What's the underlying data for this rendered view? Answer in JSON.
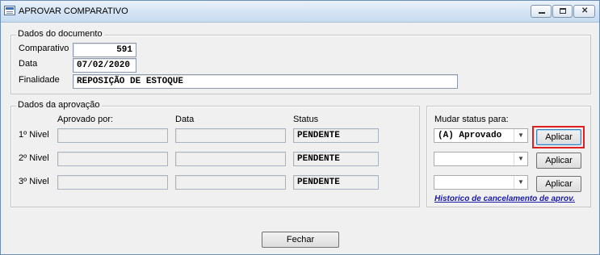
{
  "window": {
    "title": "APROVAR COMPARATIVO"
  },
  "doc": {
    "group_label": "Dados do documento",
    "comparativo_label": "Comparativo",
    "comparativo_value": "591",
    "data_label": "Data",
    "data_value": "07/02/2020",
    "finalidade_label": "Finalidade",
    "finalidade_value": "REPOSIÇÃO DE ESTOQUE"
  },
  "approval": {
    "group_label": "Dados da aprovação",
    "col_aprovado": "Aprovado por:",
    "col_data": "Data",
    "col_status": "Status",
    "rows": [
      {
        "label": "1º Nivel",
        "aprovado": "",
        "data": "",
        "status": "PENDENTE"
      },
      {
        "label": "2º Nivel",
        "aprovado": "",
        "data": "",
        "status": "PENDENTE"
      },
      {
        "label": "3º Nivel",
        "aprovado": "",
        "data": "",
        "status": "PENDENTE"
      }
    ]
  },
  "status_change": {
    "label": "Mudar status para:",
    "selects": [
      "(A) Aprovado",
      "",
      ""
    ],
    "apply_label": "Aplicar",
    "history_link": "Historico de cancelamento de aprov."
  },
  "footer": {
    "close_label": "Fechar"
  }
}
